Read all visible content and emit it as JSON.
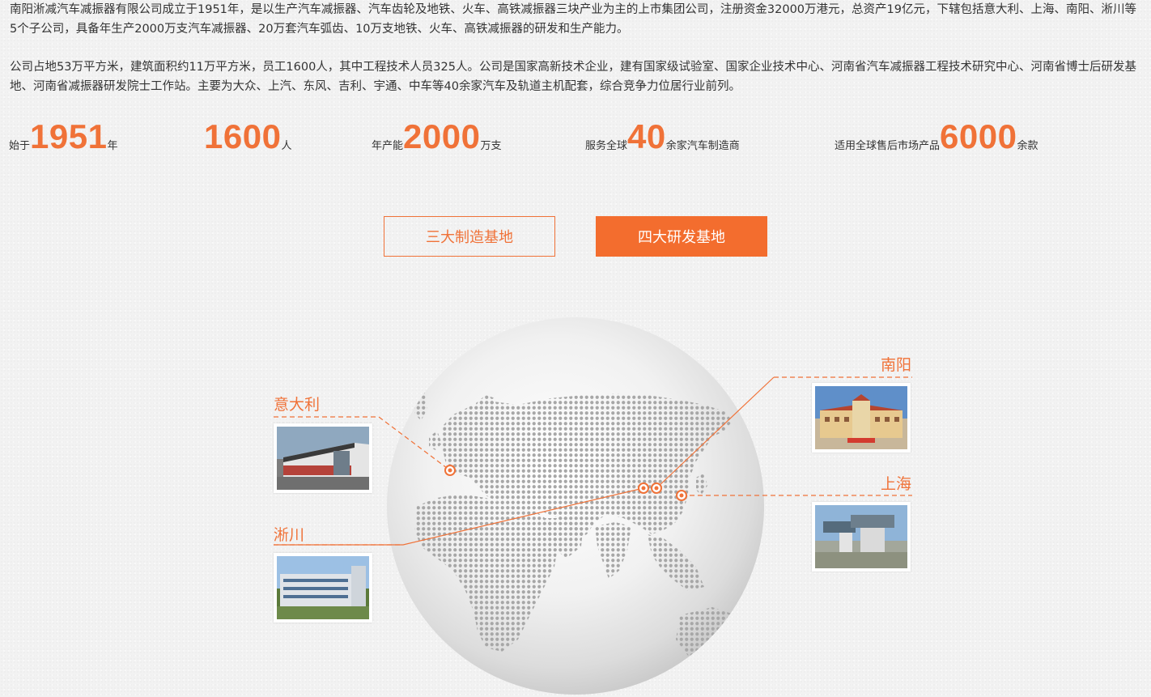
{
  "intro": {
    "p1": "南阳淅减汽车减振器有限公司成立于1951年，是以生产汽车减振器、汽车齿轮及地铁、火车、高铁减振器三块产业为主的上市集团公司，注册资金32000万港元，总资产19亿元，下辖包括意大利、上海、南阳、淅川等5个子公司，具备年生产2000万支汽车减振器、20万套汽车弧齿、10万支地铁、火车、高铁减振器的研发和生产能力。",
    "p2": "公司占地53万平方米，建筑面积约11万平方米，员工1600人，其中工程技术人员325人。公司是国家高新技术企业，建有国家级试验室、国家企业技术中心、河南省汽车减振器工程技术研究中心、河南省博士后研发基地、河南省减振器研发院士工作站。主要为大众、上汽、东风、吉利、宇通、中车等40余家汽车及轨道主机配套，综合竞争力位居行业前列。"
  },
  "stats": [
    {
      "prefix": "始于",
      "number": "1951",
      "suffix": "年"
    },
    {
      "prefix": "",
      "number": "1600",
      "suffix": "人"
    },
    {
      "prefix": "年产能",
      "number": "2000",
      "suffix": "万支"
    },
    {
      "prefix": "服务全球",
      "number": "40",
      "suffix": "余家汽车制造商"
    },
    {
      "prefix": "适用全球售后市场产品",
      "number": "6000",
      "suffix": "余款"
    }
  ],
  "tabs": {
    "manufacturing": "三大制造基地",
    "rnd": "四大研发基地",
    "active": "rnd"
  },
  "bases": {
    "italy": "意大利",
    "xichuan": "淅川",
    "nanyang": "南阳",
    "shanghai": "上海"
  },
  "colors": {
    "accent": "#f07238",
    "active_tab_bg": "#f36d2e",
    "text": "#333333",
    "background": "#f2f2f2"
  }
}
